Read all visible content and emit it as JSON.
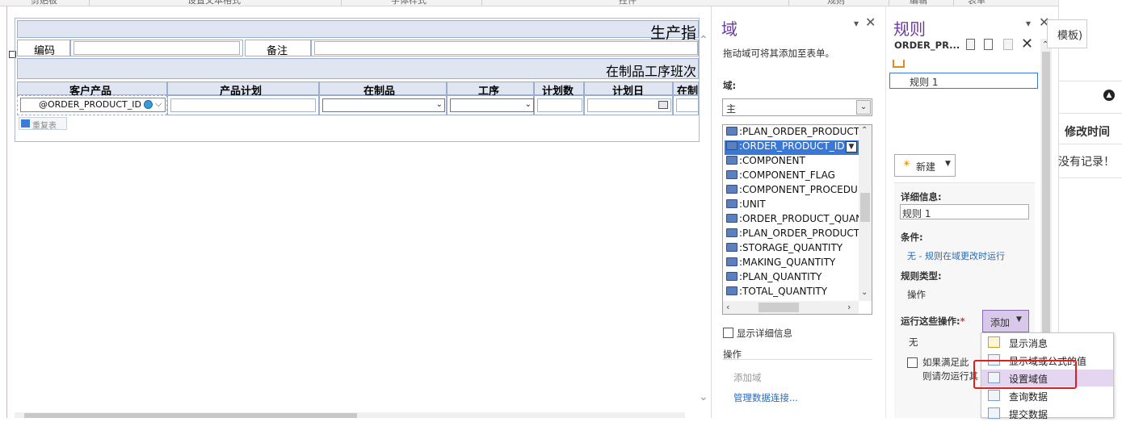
{
  "ribbon": {
    "labels": [
      "剪贴板",
      "设置文本格式",
      "字体样式",
      "控件",
      "规则",
      "编辑",
      "表单"
    ]
  },
  "form": {
    "title": "生产指",
    "code_label": "编码",
    "note_label": "备注",
    "section_title": "在制品工序班次",
    "columns": [
      "客户产品",
      "产品计划",
      "在制品",
      "工序",
      "计划数",
      "计划日",
      "在制"
    ],
    "order_product_field": "@ORDER_PRODUCT_ID",
    "repeat_table_label": "重复表"
  },
  "fields_panel": {
    "title": "域",
    "hint": "拖动域可将其添加至表单。",
    "field_label": "域:",
    "field_select": "主",
    "fields": [
      ":PLAN_ORDER_PRODUCT",
      ":ORDER_PRODUCT_ID",
      ":COMPONENT",
      ":COMPONENT_FLAG",
      ":COMPONENT_PROCEDU",
      ":UNIT",
      ":ORDER_PRODUCT_QUAN",
      ":PLAN_ORDER_PRODUCT",
      ":STORAGE_QUANTITY",
      ":MAKING_QUANTITY",
      ":PLAN_QUANTITY",
      ":TOTAL_QUANTITY"
    ],
    "selected_field_index": 1,
    "show_details": "显示详细信息",
    "actions_label": "操作",
    "add_field": "添加域",
    "manage_connections": "管理数据连接..."
  },
  "rules_panel": {
    "title": "规则",
    "target": "ORDER_PR...",
    "rule_item": "规则 1",
    "new_button": "新建",
    "details_label": "详细信息:",
    "details_value": "规则 1",
    "condition_label": "条件:",
    "condition_value": "无 - 规则在域更改时运行",
    "rule_type_label": "规则类型:",
    "rule_type_value": "操作",
    "run_actions_label": "运行这些操作:",
    "required_mark": "*",
    "add_button": "添加",
    "none_value": "无",
    "checkbox_label_line1": "如果满足此",
    "checkbox_label_line2": "则请勿运行其"
  },
  "dropdown_menu": {
    "items": [
      "显示消息",
      "显示域或公式的值",
      "设置域值",
      "查询数据",
      "提交数据"
    ],
    "highlighted_index": 2
  },
  "right_area": {
    "template_text": "模板)",
    "modified_time": "修改时间",
    "no_records": "没有记录！"
  },
  "colors": {
    "panel_title": "#6a3d9a",
    "selection": "#3a78d6",
    "highlight_box": "#e01e1e"
  }
}
